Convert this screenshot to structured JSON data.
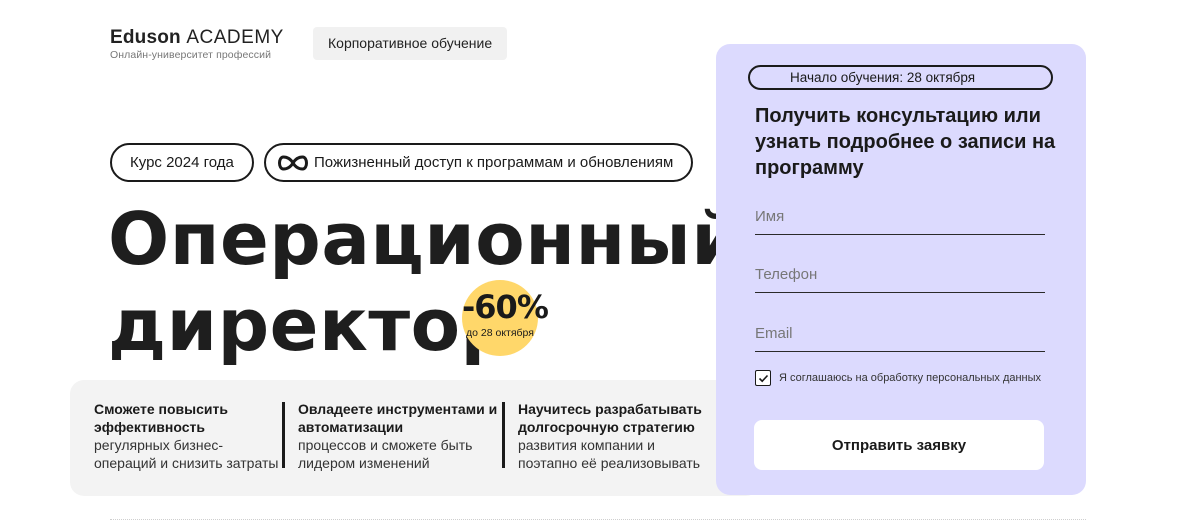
{
  "header": {
    "logo_brand": "Eduson",
    "logo_academy": "ACADEMY",
    "logo_tagline": "Онлайн-университет профессий",
    "corporate_button": "Корпоративное обучение"
  },
  "hero": {
    "pill_year": "Курс 2024 года",
    "pill_access": "Пожизненный доступ к программам и обновлениям",
    "title_line1": "Операционный",
    "title_line2": "директор",
    "discount_percent": "-60%",
    "discount_until": "до 28 октября"
  },
  "features": [
    {
      "heading": "Сможете повысить эффективность",
      "text": "регулярных бизнес-операций и снизить затраты"
    },
    {
      "heading": "Овладеете инструментами и автоматизации",
      "text": "процессов и сможете быть лидером изменений"
    },
    {
      "heading": "Научитесь разрабатывать долгосрочную стратегию",
      "text": "развития компании и поэтапно её реализовывать"
    }
  ],
  "form": {
    "start_date": "Начало обучения: 28 октября",
    "title": "Получить консультацию или узнать подробнее о записи на программу",
    "name_placeholder": "Имя",
    "phone_placeholder": "Телефон",
    "email_placeholder": "Email",
    "consent_checked": true,
    "consent_text": "Я соглашаюсь на обработку персональных данных",
    "submit_label": "Отправить заявку"
  },
  "colors": {
    "form_background": "#dcdafe",
    "discount_badge": "#ffd76a",
    "features_background": "#f3f3f3"
  }
}
